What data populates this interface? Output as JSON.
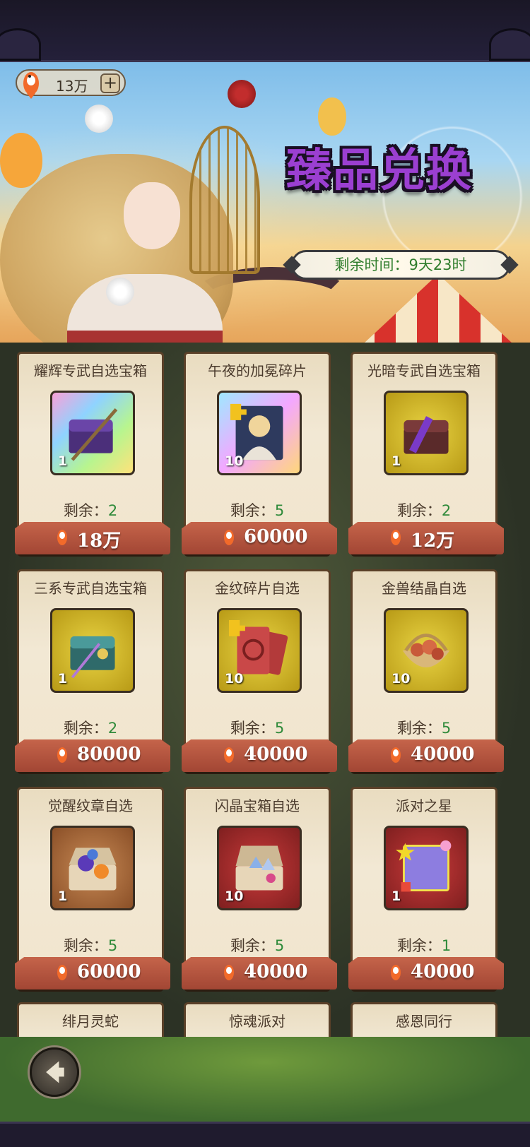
{
  "header": {
    "currency_amount": "13万",
    "add_label": "+",
    "title": "臻品兑换",
    "timer_text": "剩余时间：9天23时"
  },
  "items": [
    {
      "name": "耀辉专武自选宝箱",
      "qty": "1",
      "remain_label": "剩余：",
      "remain": "2",
      "price": "18万",
      "frame": "rainbow",
      "icon": "chest-weapon-icon"
    },
    {
      "name": "午夜的加冕碎片",
      "qty": "10",
      "remain_label": "剩余：",
      "remain": "5",
      "price": "60000",
      "frame": "rainbow",
      "icon": "hero-shard-icon"
    },
    {
      "name": "光暗专武自选宝箱",
      "qty": "1",
      "remain_label": "剩余：",
      "remain": "2",
      "price": "12万",
      "frame": "gold",
      "icon": "chest-weapon-dark-icon"
    },
    {
      "name": "三系专武自选宝箱",
      "qty": "1",
      "remain_label": "剩余：",
      "remain": "2",
      "price": "80000",
      "frame": "gold",
      "icon": "chest-weapon-teal-icon"
    },
    {
      "name": "金纹碎片自选",
      "qty": "10",
      "remain_label": "剩余：",
      "remain": "5",
      "price": "40000",
      "frame": "gold",
      "icon": "card-shard-icon"
    },
    {
      "name": "金兽结晶自选",
      "qty": "10",
      "remain_label": "剩余：",
      "remain": "5",
      "price": "40000",
      "frame": "gold",
      "icon": "crystal-basket-icon"
    },
    {
      "name": "觉醒纹章自选",
      "qty": "1",
      "remain_label": "剩余：",
      "remain": "5",
      "price": "60000",
      "frame": "bronze",
      "icon": "emblem-chest-icon"
    },
    {
      "name": "闪晶宝箱自选",
      "qty": "10",
      "remain_label": "剩余：",
      "remain": "5",
      "price": "40000",
      "frame": "red",
      "icon": "gem-chest-icon"
    },
    {
      "name": "派对之星",
      "qty": "1",
      "remain_label": "剩余：",
      "remain": "1",
      "price": "40000",
      "frame": "red",
      "icon": "party-frame-icon"
    }
  ],
  "partial_items": [
    "绯月灵蛇",
    "惊魂派对",
    "感恩同行"
  ],
  "colors": {
    "accent": "#9b3fd1",
    "remain_green": "#2f8a3a",
    "price_bar": "#b04e3a"
  }
}
